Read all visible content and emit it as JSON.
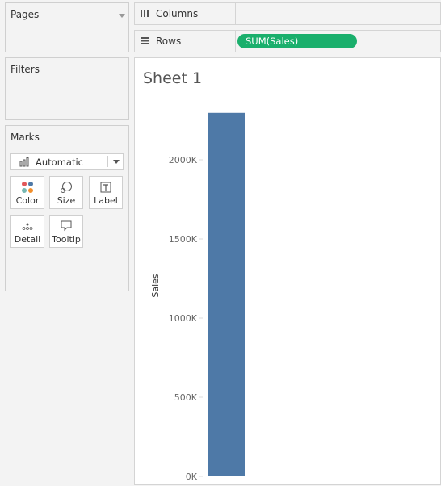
{
  "pages": {
    "title": "Pages"
  },
  "filters": {
    "title": "Filters"
  },
  "marks": {
    "title": "Marks",
    "mark_type": "Automatic",
    "buttons": [
      {
        "label": "Color",
        "icon": "color-icon"
      },
      {
        "label": "Size",
        "icon": "size-icon"
      },
      {
        "label": "Label",
        "icon": "label-icon"
      },
      {
        "label": "Detail",
        "icon": "detail-icon"
      },
      {
        "label": "Tooltip",
        "icon": "tooltip-icon"
      }
    ]
  },
  "shelves": {
    "columns": {
      "label": "Columns",
      "pills": []
    },
    "rows": {
      "label": "Rows",
      "pills": [
        "SUM(Sales)"
      ]
    }
  },
  "sheet": {
    "title": "Sheet 1"
  },
  "chart_data": {
    "type": "bar",
    "categories": [
      ""
    ],
    "values": [
      2297000
    ],
    "ylabel": "Sales",
    "yticks": [
      "0K",
      "500K",
      "1000K",
      "1500K",
      "2000K"
    ],
    "ytick_values": [
      0,
      500000,
      1000000,
      1500000,
      2000000
    ],
    "ylim": [
      0,
      2300000
    ],
    "colors": {
      "bar": "#4e79a7",
      "pill": "#1aaf6c"
    },
    "grid": false
  }
}
